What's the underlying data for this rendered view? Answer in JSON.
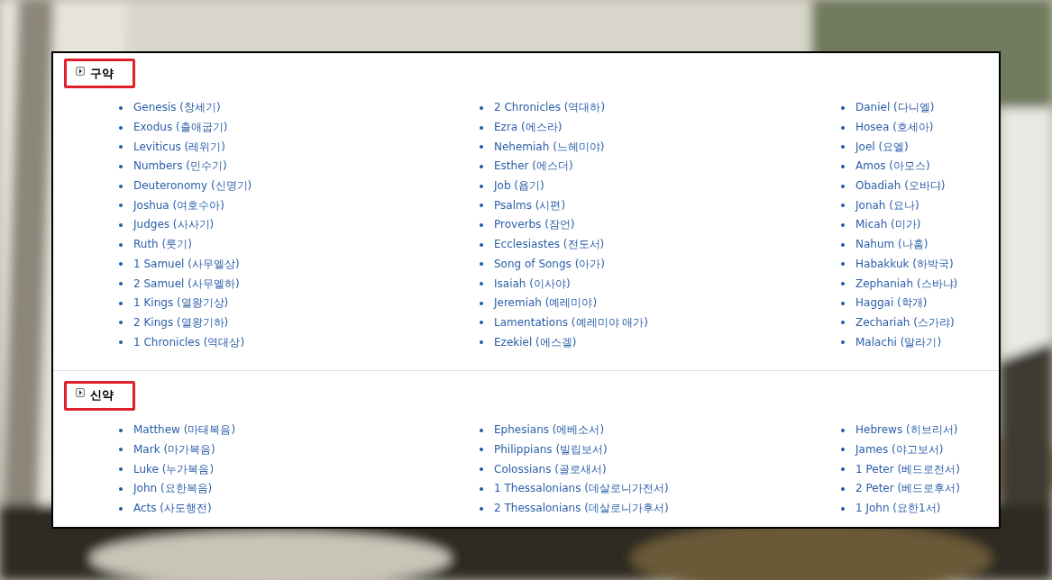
{
  "sections": [
    {
      "title": "구약",
      "highlighted": true,
      "columns": [
        [
          "Genesis (창세기)",
          "Exodus (출애굽기)",
          "Leviticus (레위기)",
          "Numbers (민수기)",
          "Deuteronomy (신명기)",
          "Joshua (여호수아)",
          "Judges (사사기)",
          "Ruth (룻기)",
          "1 Samuel (사무엘상)",
          "2 Samuel (사무엘하)",
          "1 Kings (열왕기상)",
          "2 Kings (열왕기하)",
          "1 Chronicles (역대상)"
        ],
        [
          "2 Chronicles (역대하)",
          "Ezra (에스라)",
          "Nehemiah (느헤미야)",
          "Esther (에스더)",
          "Job (욥기)",
          "Psalms (시편)",
          "Proverbs (잠언)",
          "Ecclesiastes (전도서)",
          "Song of Songs (아가)",
          "Isaiah (이사야)",
          "Jeremiah (예레미야)",
          "Lamentations (예레미야 애가)",
          "Ezekiel (에스겔)"
        ],
        [
          "Daniel (다니엘)",
          "Hosea (호세아)",
          "Joel (요엘)",
          "Amos (아모스)",
          "Obadiah (오바댜)",
          "Jonah (요나)",
          "Micah (미가)",
          "Nahum (나훔)",
          "Habakkuk (하박국)",
          "Zephaniah (스바냐)",
          "Haggai (학개)",
          "Zechariah (스가랴)",
          "Malachi (말라기)"
        ]
      ]
    },
    {
      "title": "신약",
      "highlighted": true,
      "columns": [
        [
          "Matthew (마태복음)",
          "Mark (마가복음)",
          "Luke (누가복음)",
          "John (요한복음)",
          "Acts (사도행전)"
        ],
        [
          "Ephesians (에베소서)",
          "Philippians (빌립보서)",
          "Colossians (골로새서)",
          "1 Thessalonians (데살로니가전서)",
          "2 Thessalonians (데살로니가후서)"
        ],
        [
          "Hebrews (히브리서)",
          "James (야고보서)",
          "1 Peter (베드로전서)",
          "2 Peter (베드로후서)",
          "1 John (요한1서)"
        ]
      ]
    }
  ]
}
